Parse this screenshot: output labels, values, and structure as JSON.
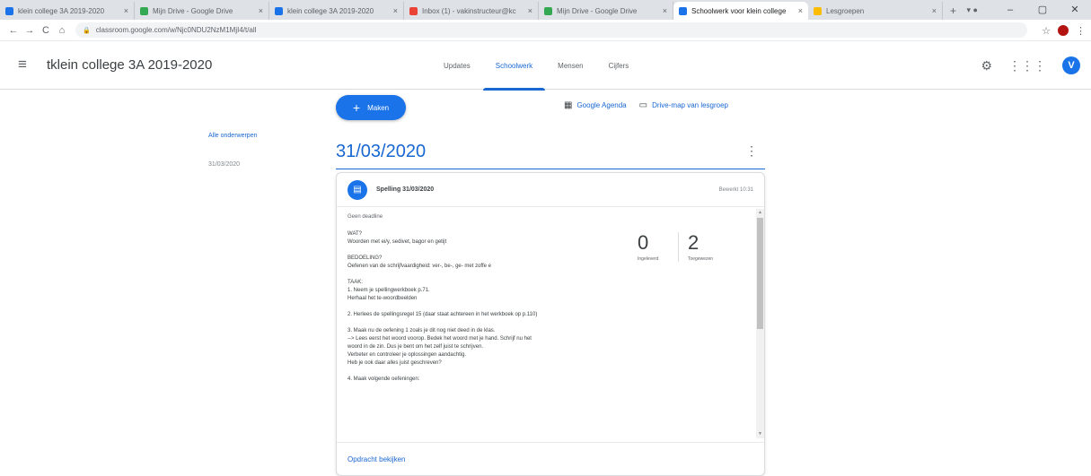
{
  "browser": {
    "tabs": [
      {
        "title": "klein college 3A 2019-2020",
        "color": "#1a73e8",
        "active": false
      },
      {
        "title": "Mijn Drive - Google Drive",
        "color": "#34a853",
        "active": false
      },
      {
        "title": "klein college 3A 2019-2020",
        "color": "#1a73e8",
        "active": false
      },
      {
        "title": "Inbox (1) - vakinstructeur@kc",
        "color": "#ea4335",
        "active": false
      },
      {
        "title": "Mijn Drive - Google Drive",
        "color": "#34a853",
        "active": false
      },
      {
        "title": "Schoolwerk voor klein college",
        "color": "#1a73e8",
        "active": true
      },
      {
        "title": "Lesgroepen",
        "color": "#fbbc04",
        "active": false
      }
    ],
    "url": "classroom.google.com/w/Njc0NDU2NzM1MjI4/t/all",
    "nav": {
      "back": "←",
      "forward": "→",
      "reload": "C",
      "home": "⌂"
    },
    "window": {
      "minimize": "–",
      "maximize": "▢",
      "close": "✕",
      "tab_menu": "▾ ●"
    }
  },
  "header": {
    "class_name": "tklein college 3A 2019-2020",
    "tabs": [
      {
        "label": "Updates",
        "active": false
      },
      {
        "label": "Schoolwerk",
        "active": true
      },
      {
        "label": "Mensen",
        "active": false
      },
      {
        "label": "Cijfers",
        "active": false
      }
    ],
    "avatar_letter": "V",
    "avatar_color": "#1a73e8"
  },
  "sidebar": {
    "all_topics": "Alle onderwerpen",
    "topics": [
      "31/03/2020"
    ]
  },
  "actions": {
    "create_label": "Maken",
    "calendar_link": "Google Agenda",
    "drive_link": "Drive-map van lesgroep"
  },
  "topic": {
    "title": "31/03/2020",
    "assignment": {
      "title": "Spelling 31/03/2020",
      "date": "Bewerkt 10:31",
      "posted": "Geen deadline",
      "description": "WAT?\nWoorden met ei/y, sedivet, bagor en getijt\n\nBEDOELING?\nOefenen van de schrijfvaardigheid: ver-, be-, ge- met zoffe e\n\nTAAK:\n1. Neem je spellingwerkboek p.71.\nHerhaal het te-woordbeelden\n\n2. Herlees de spellingsregel 15 (daar staat achtereen in het werkboek op p.110)\n\n3. Maak nu de oefening 1 zoals je dit nog niet deed in de klas.\n--> Lees eerst het woord voorop. Bedek het woord met je hand. Schrijf nu het\nwoord in de zin. Dus je bent om het zelf juist te schrijven.\nVerbeter en controleer je oplossingen aandachtig.\nHeb je ook daar alles juist geschreven?\n\n4. Maak volgende oefeningen:",
      "stats": [
        {
          "value": "0",
          "label": "Ingeleverd"
        },
        {
          "value": "2",
          "label": "Toegewezen"
        }
      ],
      "view_link": "Opdracht bekijken"
    }
  }
}
